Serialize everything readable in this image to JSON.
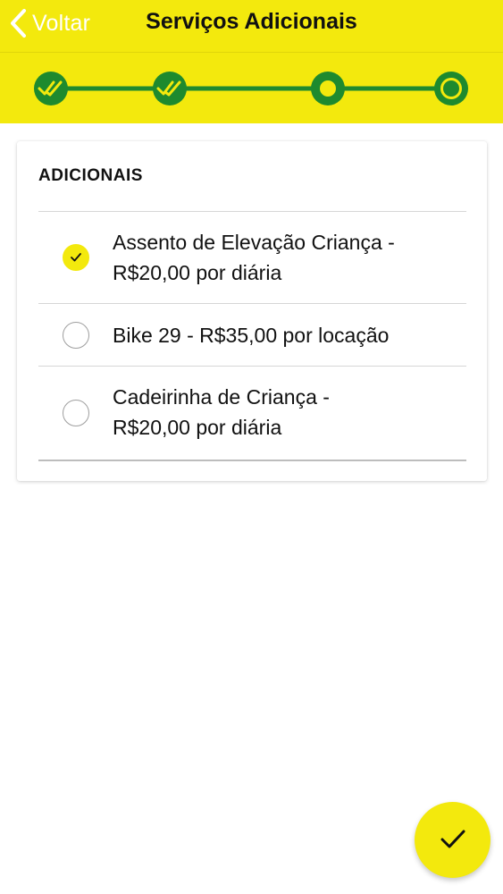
{
  "navbar": {
    "back_label": "Voltar",
    "title": "Serviços Adicionais"
  },
  "stepper": {
    "steps": [
      {
        "state": "completed"
      },
      {
        "state": "completed"
      },
      {
        "state": "current"
      },
      {
        "state": "pending"
      }
    ]
  },
  "additionals": {
    "title": "ADICIONAIS",
    "options": [
      {
        "line1": "Assento de Elevação Criança -",
        "line2": "R$20,00 por diária",
        "checked": true
      },
      {
        "line1": "Bike 29 - R$35,00 por locação",
        "line2": "",
        "checked": false
      },
      {
        "line1": "Cadeirinha de Criança -",
        "line2": "R$20,00 por diária",
        "checked": false
      }
    ]
  },
  "colors": {
    "accent_yellow": "#f3e90d",
    "stepper_green": "#1e8a2e",
    "back_text": "#ffffff"
  },
  "icons": {
    "back": "chevron-left-icon",
    "step_done": "double-check-icon",
    "confirm": "check-icon"
  }
}
